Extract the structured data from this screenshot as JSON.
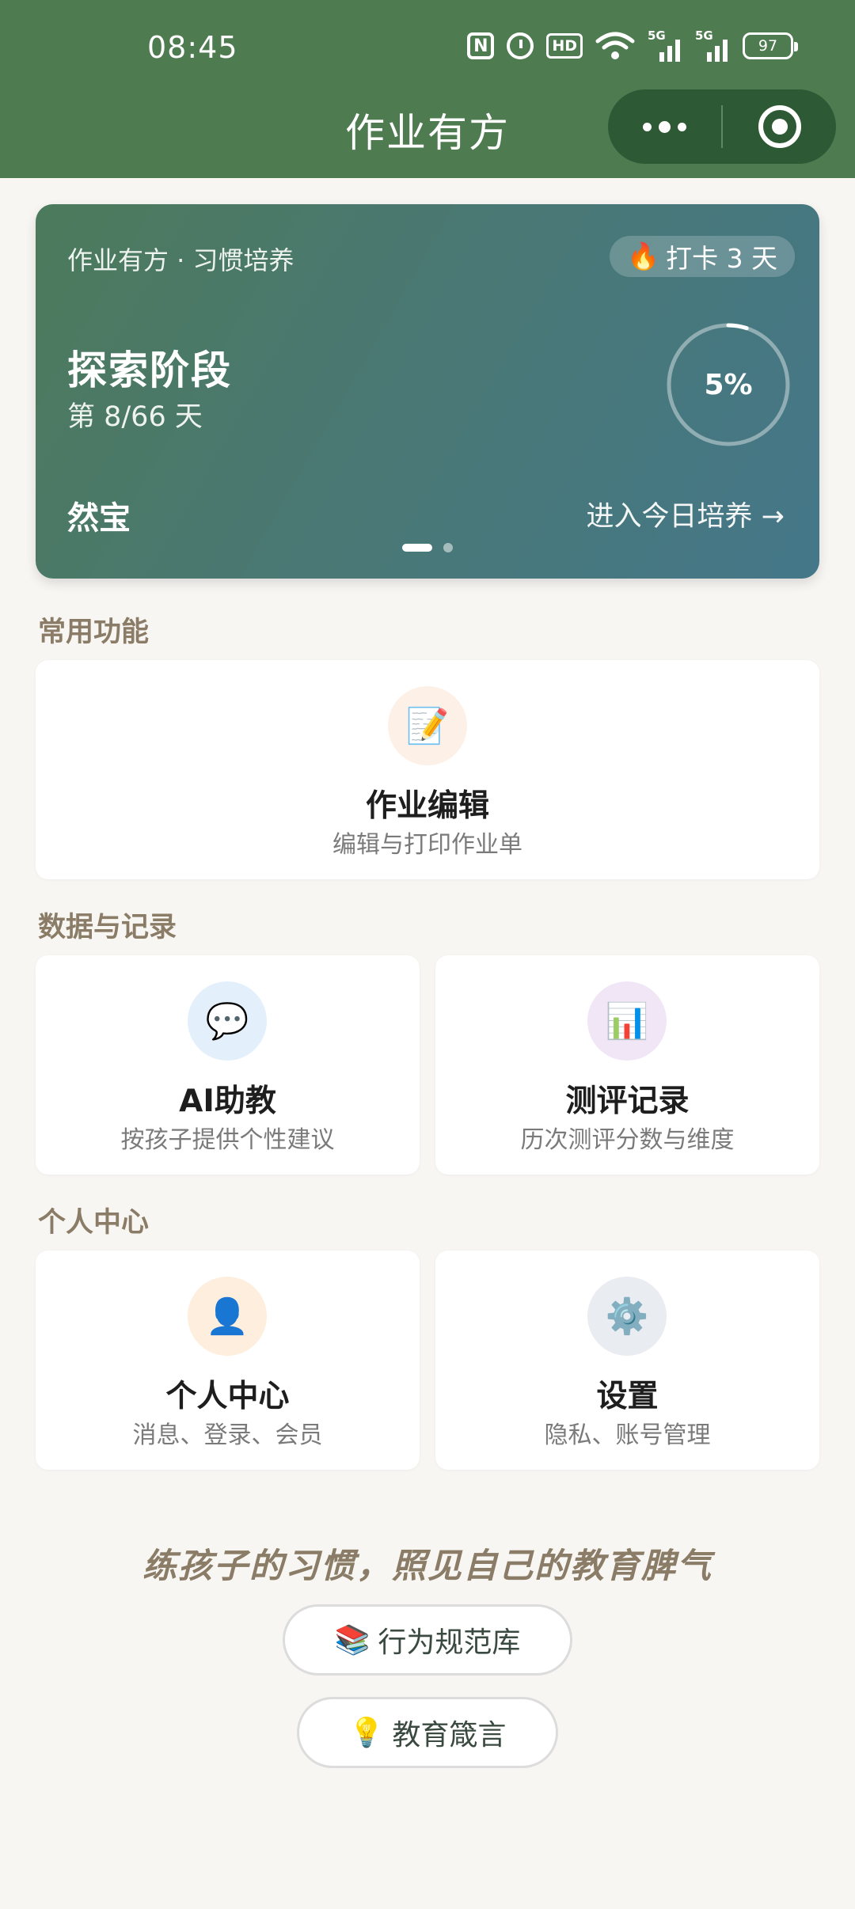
{
  "status_bar": {
    "time": "08:45",
    "nfc": "N",
    "hd": "HD",
    "signal_tag": "5G",
    "battery": "97"
  },
  "nav": {
    "title": "作业有方",
    "more_icon": "more-dots-icon",
    "close_icon": "target-icon"
  },
  "hero": {
    "subtitle": "作业有方 · 习惯培养",
    "streak": "打卡 3 天",
    "streak_icon": "🔥",
    "stage": "探索阶段",
    "day": "第 8/66 天",
    "progress_label": "5%",
    "progress": 0.05,
    "child_name": "然宝",
    "enter_label": "进入今日培养 →",
    "pages": 2,
    "active_page": 1
  },
  "sections": {
    "common": "常用功能",
    "data": "数据与记录",
    "personal": "个人中心"
  },
  "cards": {
    "homework": {
      "icon": "📝",
      "title": "作业编辑",
      "desc": "编辑与打印作业单"
    },
    "ai": {
      "icon": "💬",
      "title": "AI助教",
      "desc": "按孩子提供个性建议"
    },
    "eval": {
      "icon": "📊",
      "title": "测评记录",
      "desc": "历次测评分数与维度"
    },
    "me": {
      "icon": "👤",
      "title": "个人中心",
      "desc": "消息、登录、会员"
    },
    "settings": {
      "icon": "⚙️",
      "title": "设置",
      "desc": "隐私、账号管理"
    }
  },
  "bottom": {
    "slogan": "练孩子的习惯，照见自己的教育脾气",
    "rules_icon": "📚",
    "rules_label": "行为规范库",
    "quotes_icon": "💡",
    "quotes_label": "教育箴言"
  },
  "colors": {
    "header": "#4e7b50",
    "capsule": "#2d5a34",
    "section_title": "#8a7c66"
  }
}
